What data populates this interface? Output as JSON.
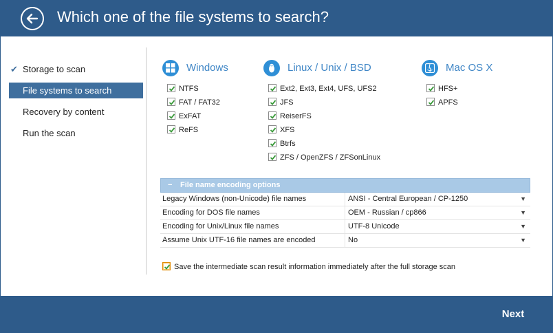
{
  "header": {
    "title": "Which one of the file systems to search?",
    "back_icon": "arrow-left-icon"
  },
  "sidebar": {
    "items": [
      {
        "label": "Storage to scan",
        "state": "done"
      },
      {
        "label": "File systems to search",
        "state": "active"
      },
      {
        "label": "Recovery by content",
        "state": "pending"
      },
      {
        "label": "Run the scan",
        "state": "pending"
      }
    ]
  },
  "groups": {
    "windows": {
      "label": "Windows",
      "icon": "windows-icon",
      "items": [
        {
          "label": "NTFS",
          "checked": true
        },
        {
          "label": "FAT / FAT32",
          "checked": true
        },
        {
          "label": "ExFAT",
          "checked": true
        },
        {
          "label": "ReFS",
          "checked": true
        }
      ]
    },
    "linux": {
      "label": "Linux / Unix / BSD",
      "icon": "linux-penguin-icon",
      "items": [
        {
          "label": "Ext2, Ext3, Ext4, UFS, UFS2",
          "checked": true
        },
        {
          "label": "JFS",
          "checked": true
        },
        {
          "label": "ReiserFS",
          "checked": true
        },
        {
          "label": "XFS",
          "checked": true
        },
        {
          "label": "Btrfs",
          "checked": true
        },
        {
          "label": "ZFS / OpenZFS / ZFSonLinux",
          "checked": true
        }
      ]
    },
    "mac": {
      "label": "Mac OS X",
      "icon": "mac-finder-icon",
      "items": [
        {
          "label": "HFS+",
          "checked": true
        },
        {
          "label": "APFS",
          "checked": true
        }
      ]
    }
  },
  "encoding": {
    "header": "File name encoding options",
    "collapse_symbol": "−",
    "rows": [
      {
        "label": "Legacy Windows (non-Unicode) file names",
        "value": "ANSI - Central European / CP-1250"
      },
      {
        "label": "Encoding for DOS file names",
        "value": "OEM - Russian / cp866"
      },
      {
        "label": "Encoding for Unix/Linux file names",
        "value": "UTF-8 Unicode"
      },
      {
        "label": "Assume Unix UTF-16 file names are encoded",
        "value": "No"
      }
    ],
    "dropdown_arrow": "▼"
  },
  "save_option": {
    "label": "Save the intermediate scan result information immediately after the full storage scan",
    "checked": true
  },
  "footer": {
    "next_label": "Next"
  },
  "colors": {
    "header_bg": "#2e5b8a",
    "accent": "#3f6f9e",
    "os_label": "#3f86c6",
    "check": "#3a9a3a",
    "table_header": "#a9c9e6"
  }
}
